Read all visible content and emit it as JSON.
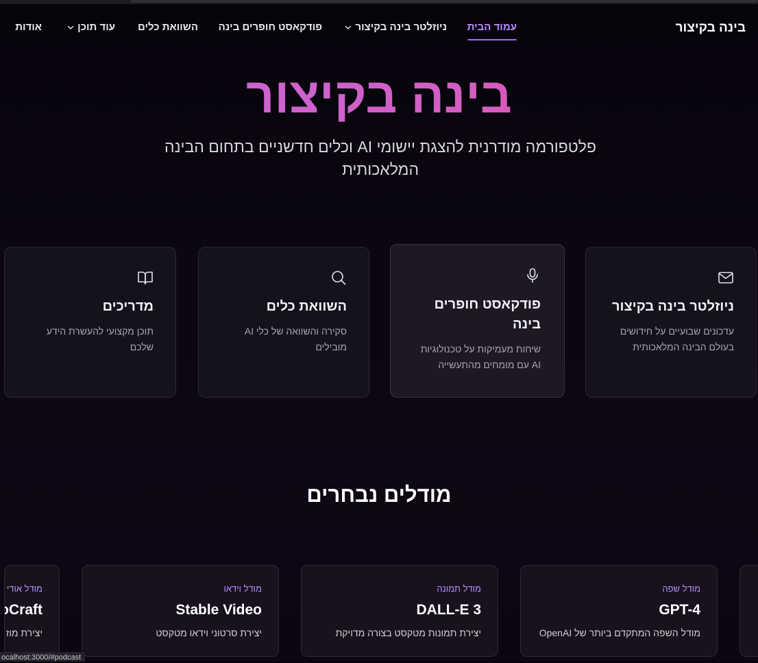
{
  "nav": {
    "brand": "בינה בקיצור",
    "items": [
      {
        "label": "עמוד הבית",
        "active": true
      },
      {
        "label": "ניוזלטר בינה בקיצור",
        "dropdown": true
      },
      {
        "label": "פודקאסט חופרים בינה"
      },
      {
        "label": "השוואת כלים"
      },
      {
        "label": "עוד תוכן",
        "dropdown": true
      },
      {
        "label": "אודות"
      }
    ]
  },
  "hero": {
    "title": "בינה בקיצור",
    "subtitle_line1": "פלטפורמה מודרנית להצגת יישומי AI וכלים חדשניים בתחום הבינה",
    "subtitle_line2": "המלאכותית"
  },
  "features": [
    {
      "icon": "mail-icon",
      "title": "ניוזלטר בינה בקיצור",
      "desc_line1": "עדכונים שבועיים על חידושים",
      "desc_line2": "בעולם הבינה המלאכותית"
    },
    {
      "icon": "microphone-icon",
      "title_line1": "פודקאסט חופרים",
      "title_line2": "בינה",
      "desc_line1": "שיחות מעמיקות על טכנולוגיות",
      "desc_line2": "AI עם מומחים מהתעשייה"
    },
    {
      "icon": "search-icon",
      "title": "השוואת כלים",
      "desc_line1": "סקירה והשוואה של כלי AI",
      "desc_line2": "מובילים"
    },
    {
      "icon": "book-icon",
      "title": "מדריכים",
      "desc_line1": "תוכן מקצועי להעשרת הידע",
      "desc_line2": "שלכם"
    }
  ],
  "models_section": {
    "title": "מודלים נבחרים",
    "models": [
      {
        "category": "מודל שפה",
        "name": "GPT-4",
        "desc": "מודל השפה המתקדם ביותר של OpenAI"
      },
      {
        "category": "מודל תמונה",
        "name": "DALL-E 3",
        "desc": "יצירת תמונות מטקסט בצורה מדויקת"
      },
      {
        "category": "מודל וידאו",
        "name": "Stable Video",
        "desc": "יצירת סרטוני וידאו מטקסט"
      },
      {
        "category": "מודל אודי",
        "name": "oCraft",
        "desc": "יצירת מוז"
      }
    ]
  },
  "status_bar": {
    "url": "ocalhost:3000/#podcast"
  },
  "colors": {
    "accent": "#b98cff",
    "title_gradient_start": "#c46ae0",
    "title_gradient_end": "#e055a8",
    "card_bg": "#16121c"
  }
}
